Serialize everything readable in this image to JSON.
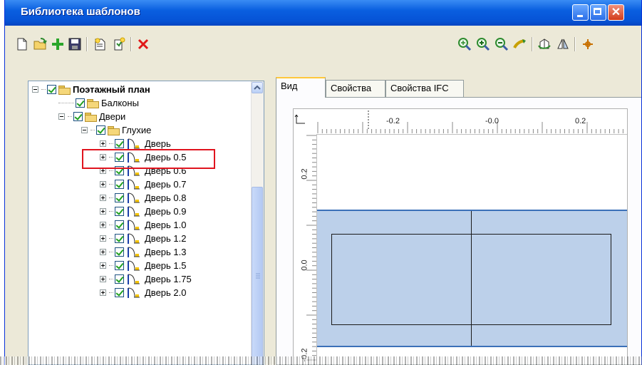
{
  "window": {
    "title": "Библиотека шаблонов"
  },
  "toolbar": {
    "left_icons": [
      "new-icon",
      "open-icon",
      "add-icon",
      "save-icon",
      "new-folder-icon",
      "new-template-icon",
      "delete-icon"
    ],
    "right_icons": [
      "zoom-extents-icon",
      "zoom-in-icon",
      "zoom-out-icon",
      "pan-icon",
      "rotate-3d-icon",
      "mirror-icon",
      "snap-icon"
    ]
  },
  "tree": {
    "items": [
      {
        "label": "Поэтажный план",
        "level": 0,
        "expanded": true,
        "type": "folder",
        "bold": true
      },
      {
        "label": "Балконы",
        "level": 1,
        "type": "folder"
      },
      {
        "label": "Двери",
        "level": 1,
        "expanded": true,
        "type": "folder"
      },
      {
        "label": "Глухие",
        "level": 2,
        "expanded": true,
        "type": "folder"
      },
      {
        "label": "Дверь",
        "level": 3,
        "type": "door",
        "highlighted": true
      },
      {
        "label": "Дверь 0.5",
        "level": 3,
        "type": "door"
      },
      {
        "label": "Дверь 0.6",
        "level": 3,
        "type": "door"
      },
      {
        "label": "Дверь 0.7",
        "level": 3,
        "type": "door"
      },
      {
        "label": "Дверь 0.8",
        "level": 3,
        "type": "door"
      },
      {
        "label": "Дверь 0.9",
        "level": 3,
        "type": "door"
      },
      {
        "label": "Дверь 1.0",
        "level": 3,
        "type": "door"
      },
      {
        "label": "Дверь 1.2",
        "level": 3,
        "type": "door"
      },
      {
        "label": "Дверь 1.3",
        "level": 3,
        "type": "door"
      },
      {
        "label": "Дверь 1.5",
        "level": 3,
        "type": "door"
      },
      {
        "label": "Дверь 1.75",
        "level": 3,
        "type": "door"
      },
      {
        "label": "Дверь 2.0",
        "level": 3,
        "type": "door"
      }
    ]
  },
  "tabs": [
    {
      "label": "Вид",
      "active": true
    },
    {
      "label": "Свойства",
      "active": false
    },
    {
      "label": "Свойства IFC",
      "active": false
    }
  ],
  "view": {
    "hruler_labels": [
      "-0.2",
      "-0.0",
      "0.2"
    ],
    "vruler_labels": [
      "0.2",
      "0.0",
      "-0.2"
    ]
  },
  "colors": {
    "titlebar": "#0a5fe0",
    "plan_fill": "#bcd0ea",
    "plan_border": "#3b70b8",
    "highlight": "#e0141e",
    "check": "#21a121"
  }
}
